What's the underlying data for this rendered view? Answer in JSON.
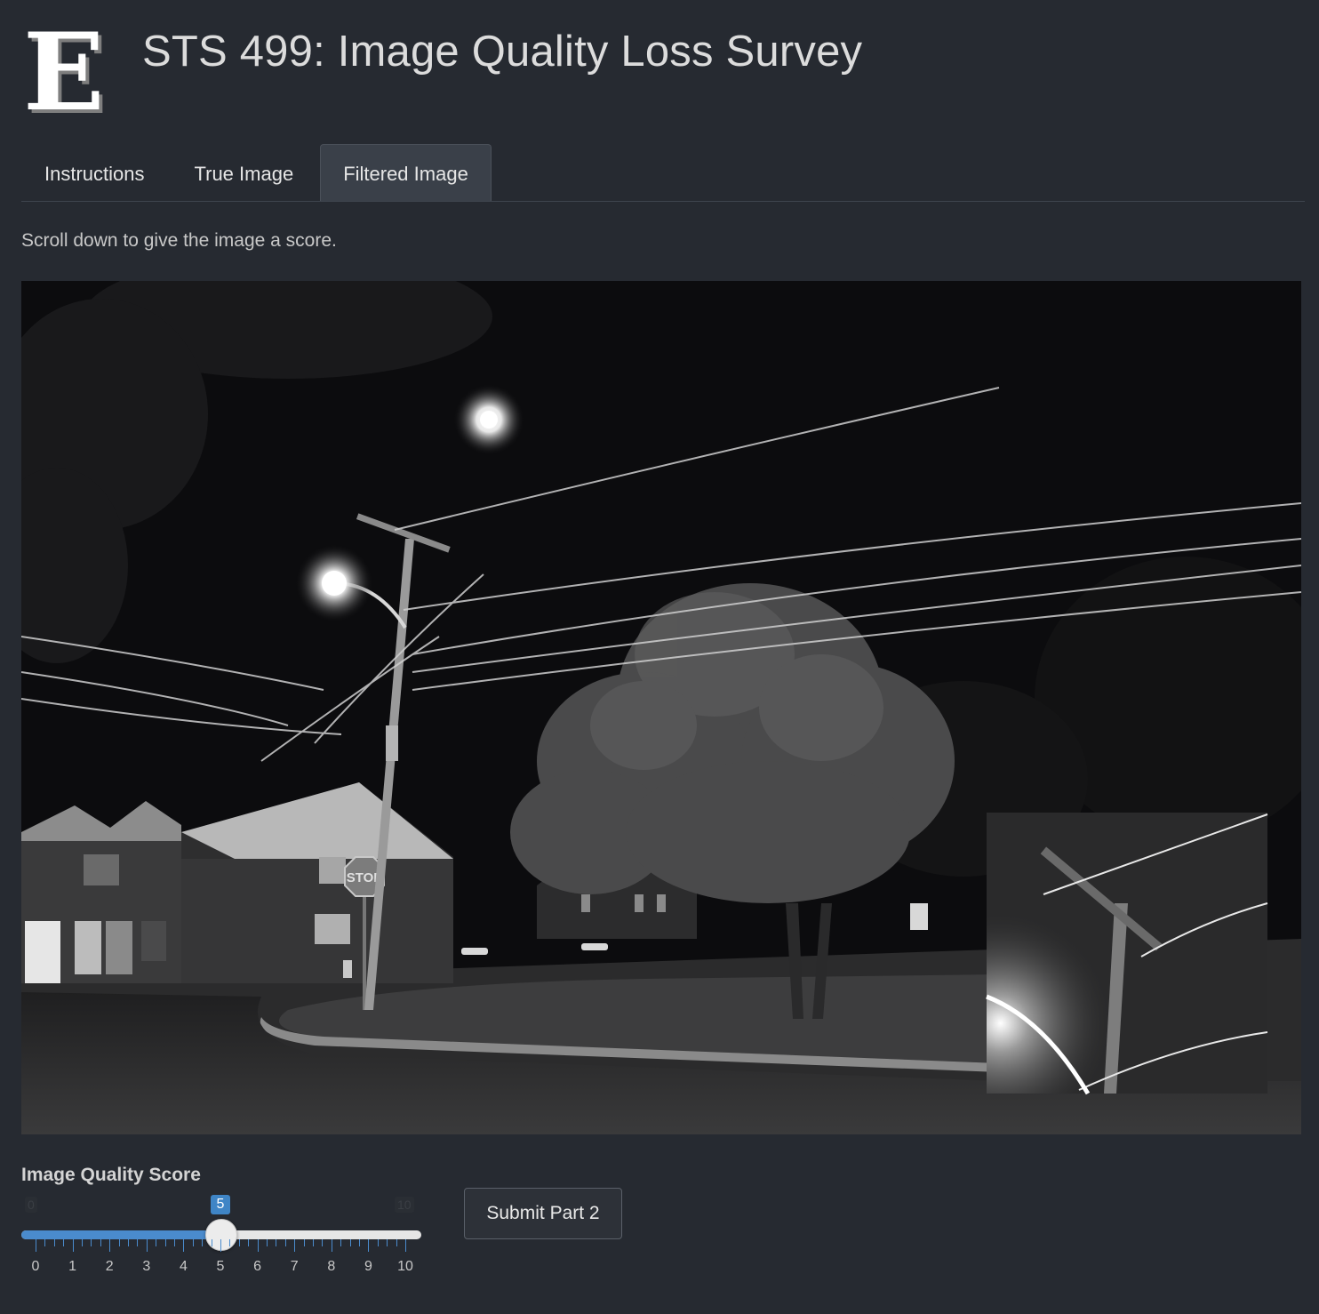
{
  "header": {
    "title": "STS 499: Image Quality Loss Survey",
    "logo_letter": "E"
  },
  "tabs": [
    {
      "label": "Instructions",
      "active": false
    },
    {
      "label": "True Image",
      "active": false
    },
    {
      "label": "Filtered Image",
      "active": true
    }
  ],
  "instructions_text": "Scroll down to give the image a score.",
  "photo": {
    "stop_sign_text": "STOP"
  },
  "score": {
    "label": "Image Quality Score",
    "min": 0,
    "max": 10,
    "value": 5,
    "min_label": "0",
    "max_label": "10",
    "value_label": "5",
    "tick_labels": [
      "0",
      "1",
      "2",
      "3",
      "4",
      "5",
      "6",
      "7",
      "8",
      "9",
      "10"
    ]
  },
  "submit_label": "Submit Part 2",
  "colors": {
    "accent": "#4a8bcd",
    "background": "#262a31"
  }
}
